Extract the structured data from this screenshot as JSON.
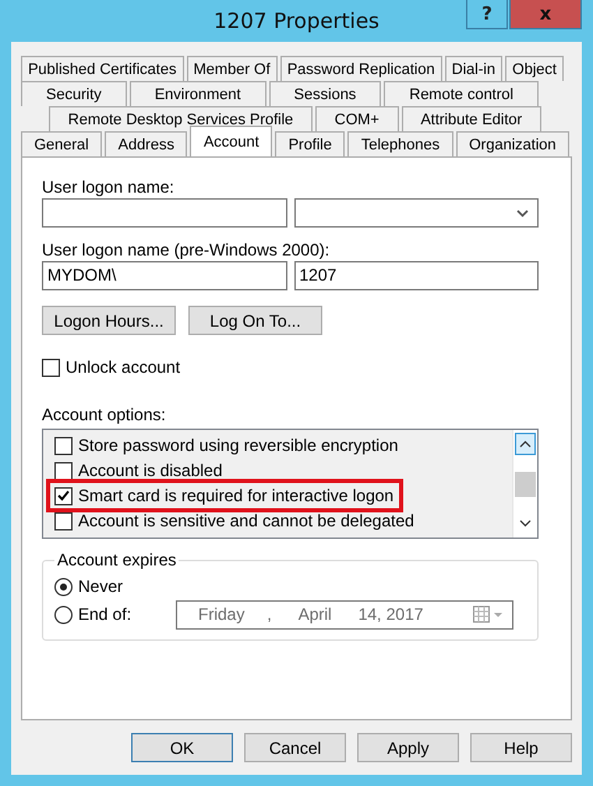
{
  "window": {
    "title": "1207 Properties",
    "help_button": "?",
    "close_button": "x"
  },
  "tab_rows": [
    [
      {
        "label": "Published Certificates",
        "selected": false
      },
      {
        "label": "Member Of",
        "selected": false
      },
      {
        "label": "Password Replication",
        "selected": false
      },
      {
        "label": "Dial-in",
        "selected": false
      },
      {
        "label": "Object",
        "selected": false
      }
    ],
    [
      {
        "label": "Security",
        "selected": false
      },
      {
        "label": "Environment",
        "selected": false
      },
      {
        "label": "Sessions",
        "selected": false
      },
      {
        "label": "Remote control",
        "selected": false
      }
    ],
    [
      {
        "label": "Remote Desktop Services Profile",
        "selected": false
      },
      {
        "label": "COM+",
        "selected": false
      },
      {
        "label": "Attribute Editor",
        "selected": false
      }
    ],
    [
      {
        "label": "General",
        "selected": false
      },
      {
        "label": "Address",
        "selected": false
      },
      {
        "label": "Account",
        "selected": true
      },
      {
        "label": "Profile",
        "selected": false
      },
      {
        "label": "Telephones",
        "selected": false
      },
      {
        "label": "Organization",
        "selected": false
      }
    ]
  ],
  "logon_name": {
    "label": "User logon name:"
  },
  "pre2000": {
    "label": "User logon name (pre-Windows 2000):",
    "domain": "MYDOM\\",
    "name": "1207"
  },
  "buttons_top": [
    "Logon Hours...",
    "Log On To..."
  ],
  "unlock": {
    "label": "Unlock account",
    "checked": false
  },
  "account_options": {
    "label": "Account options:",
    "items": [
      {
        "label": "Store password using reversible encryption",
        "checked": false,
        "highlighted": false
      },
      {
        "label": "Account is disabled",
        "checked": false,
        "highlighted": false
      },
      {
        "label": "Smart card is required for interactive logon",
        "checked": true,
        "highlighted": true
      },
      {
        "label": "Account is sensitive and cannot be delegated",
        "checked": false,
        "highlighted": false
      }
    ]
  },
  "account_expires": {
    "label": "Account expires",
    "options": [
      {
        "label": "Never",
        "selected": true
      },
      {
        "label": "End of:",
        "selected": false
      }
    ],
    "date": {
      "weekday": "Friday",
      "sep": ",",
      "month": "April",
      "day_year": "14, 2017",
      "disabled": true
    }
  },
  "footer_buttons": [
    {
      "label": "OK",
      "default": true
    },
    {
      "label": "Cancel",
      "default": false
    },
    {
      "label": "Apply",
      "default": false
    },
    {
      "label": "Help",
      "default": false
    }
  ]
}
